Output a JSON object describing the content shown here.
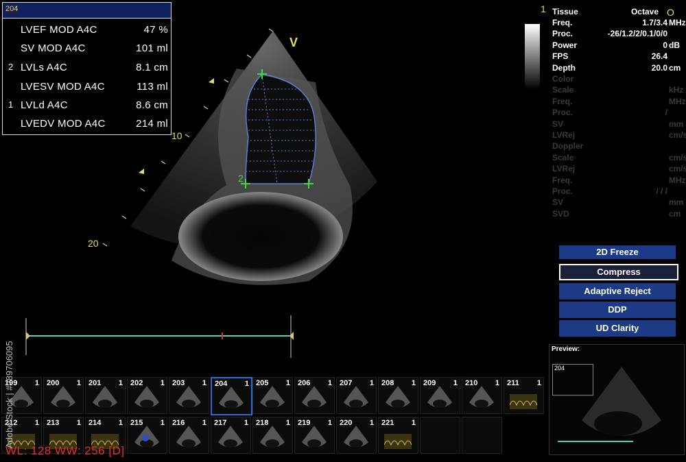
{
  "measurement_panel": {
    "frame": "204",
    "rows": [
      {
        "idx": "",
        "label": "LVEF MOD A4C",
        "value": "47 %"
      },
      {
        "idx": "",
        "label": "SV MOD A4C",
        "value": "101 ml"
      },
      {
        "idx": "2",
        "label": "LVLs A4C",
        "value": "8.1 cm"
      },
      {
        "idx": "",
        "label": "LVESV MOD A4C",
        "value": "113 ml"
      },
      {
        "idx": "1",
        "label": "LVLd A4C",
        "value": "8.6 cm"
      },
      {
        "idx": "",
        "label": "LVEDV MOD A4C",
        "value": "214 ml"
      }
    ]
  },
  "image_labels": {
    "probe_marker": "V",
    "depth_10": "10",
    "depth_20": "20",
    "trace_point_2": "2",
    "corner_index": "1",
    "corner_glyph": "O"
  },
  "params": {
    "title_left": "Tissue",
    "title_right": "Octave",
    "rows": [
      {
        "label": "Freq.",
        "value": "1.7/3.4",
        "unit": "MHz",
        "dim": false
      },
      {
        "label": "Proc.",
        "value": "-26/1.2/2/0.1/0/0",
        "unit": "",
        "dim": false
      },
      {
        "label": "Power",
        "value": "0",
        "unit": "dB",
        "dim": false
      },
      {
        "label": "FPS",
        "value": "26.4",
        "unit": "",
        "dim": false
      },
      {
        "label": "Depth",
        "value": "20.0",
        "unit": "cm",
        "dim": false
      },
      {
        "label": "Color",
        "value": "",
        "unit": "",
        "dim": true
      },
      {
        "label": "Scale",
        "value": "",
        "unit": "kHz",
        "dim": true
      },
      {
        "label": "Freq.",
        "value": "",
        "unit": "MHz",
        "dim": true
      },
      {
        "label": "Proc.",
        "value": "/",
        "unit": "",
        "dim": true
      },
      {
        "label": "SV",
        "value": "",
        "unit": "mm",
        "dim": true
      },
      {
        "label": "LVRej",
        "value": "",
        "unit": "cm/s",
        "dim": true
      },
      {
        "label": "Doppler",
        "value": "",
        "unit": "",
        "dim": true
      },
      {
        "label": "Scale",
        "value": "",
        "unit": "cm/s",
        "dim": true
      },
      {
        "label": "LVRej",
        "value": "",
        "unit": "cm/s",
        "dim": true
      },
      {
        "label": "Freq.",
        "value": "",
        "unit": "MHz",
        "dim": true
      },
      {
        "label": "Proc.",
        "value": "/ / /",
        "unit": "",
        "dim": true
      },
      {
        "label": "SV",
        "value": "",
        "unit": "mm",
        "dim": true
      },
      {
        "label": "SVD",
        "value": "",
        "unit": "cm",
        "dim": true
      }
    ]
  },
  "buttons": {
    "freeze": "2D Freeze",
    "compress": "Compress",
    "adaptive_reject": "Adaptive Reject",
    "ddp": "DDP",
    "ud_clarity": "UD Clarity"
  },
  "preview": {
    "label": "Preview:",
    "frame": "204"
  },
  "thumbnails_row1": [
    {
      "n": "199",
      "c": "1"
    },
    {
      "n": "200",
      "c": "1"
    },
    {
      "n": "201",
      "c": "1"
    },
    {
      "n": "202",
      "c": "1"
    },
    {
      "n": "203",
      "c": "1"
    },
    {
      "n": "204",
      "c": "1"
    },
    {
      "n": "205",
      "c": "1"
    },
    {
      "n": "206",
      "c": "1"
    },
    {
      "n": "207",
      "c": "1"
    },
    {
      "n": "208",
      "c": "1"
    },
    {
      "n": "209",
      "c": "1"
    },
    {
      "n": "210",
      "c": "1"
    },
    {
      "n": "211",
      "c": "1"
    }
  ],
  "thumbnails_row2": [
    {
      "n": "212",
      "c": "1"
    },
    {
      "n": "213",
      "c": "1"
    },
    {
      "n": "214",
      "c": "1"
    },
    {
      "n": "215",
      "c": "1"
    },
    {
      "n": "216",
      "c": "1"
    },
    {
      "n": "217",
      "c": "1"
    },
    {
      "n": "218",
      "c": "1"
    },
    {
      "n": "219",
      "c": "1"
    },
    {
      "n": "220",
      "c": "1"
    },
    {
      "n": "221",
      "c": "1"
    },
    {
      "n": "",
      "c": ""
    },
    {
      "n": "",
      "c": ""
    }
  ],
  "window_level": "WL: 128 WW: 256 [D]",
  "stock_id": "Adobe Stock | #289706095"
}
